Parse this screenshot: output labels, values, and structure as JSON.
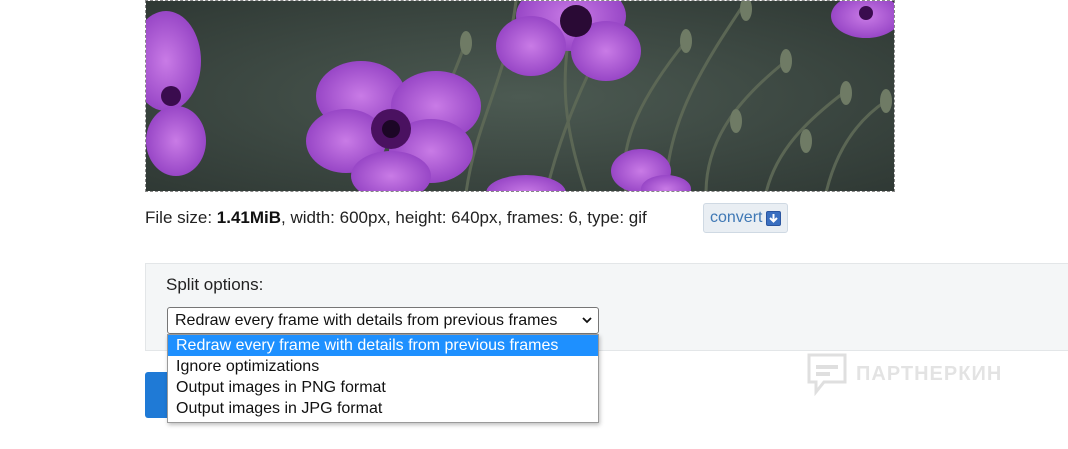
{
  "file_info": {
    "prefix": "File size: ",
    "size": "1.41MiB",
    "details": ", width: 600px, height: 640px, frames: 6, type: gif",
    "convert_label": "convert"
  },
  "split_options": {
    "label": "Split options:",
    "selected": "Redraw every frame with details from previous frames",
    "options": [
      "Redraw every frame with details from previous frames",
      "Ignore optimizations",
      "Output images in PNG format",
      "Output images in JPG format"
    ]
  },
  "watermark": {
    "text": "ПАРТНЕРКИН"
  },
  "colors": {
    "accent": "#1f7ad6",
    "selected_option": "#1e90ff",
    "panel_bg": "#f4f6f7",
    "link": "#3f78b5"
  },
  "icons": {
    "convert": "download-arrow-icon",
    "select": "chevron-down-icon",
    "watermark": "chat-bubble-icon"
  }
}
